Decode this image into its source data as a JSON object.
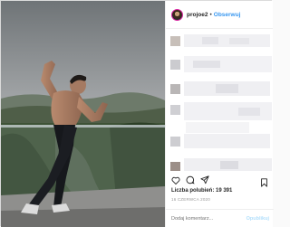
{
  "header": {
    "username": "projoe2",
    "separator": "•",
    "follow_label": "Obserwuj"
  },
  "icons": {
    "like": "heart-icon",
    "comment": "comment-icon",
    "share": "share-icon",
    "save": "bookmark-icon"
  },
  "likes": {
    "label": "Liczba polubień: 19 391"
  },
  "date": "16 CZERWCA 2020",
  "comment_box": {
    "placeholder": "Dodaj komentarz...",
    "post_label": "Opublikuj"
  },
  "colors": {
    "link_blue": "#3897f0",
    "text": "#262626",
    "muted": "#999999",
    "pixelation": [
      "#f2f2f4",
      "#e9e9ee",
      "#dcdce0",
      "#c9c9cc",
      "#b8b3b3",
      "#9c8f88"
    ]
  }
}
